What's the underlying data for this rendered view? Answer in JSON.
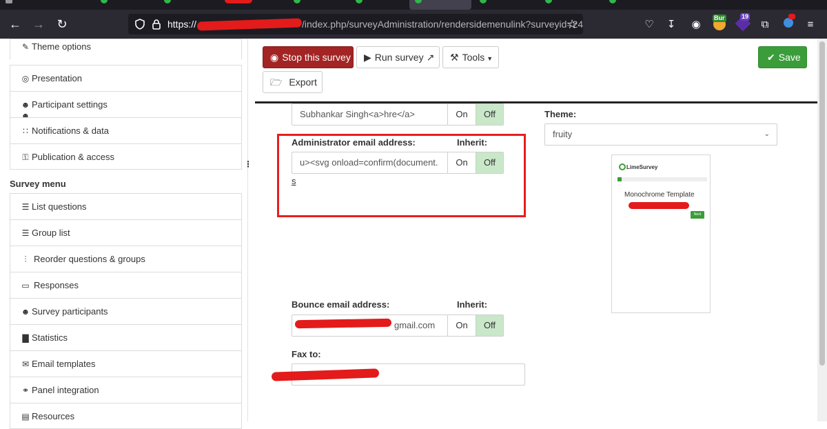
{
  "browser": {
    "url_scheme": "https://",
    "url_path": "/index.php/surveyAdministration/rendersidemenulink?surveyid=24",
    "extension_badge_count": "19",
    "extension_badge_label": "Bur"
  },
  "sidebar": {
    "settings_items": [
      {
        "label": "Theme options",
        "icon": "brush-icon"
      },
      {
        "label": "Presentation",
        "icon": "eye-slash-icon"
      },
      {
        "label": "Participant settings",
        "icon": "users-icon"
      },
      {
        "label": "Notifications & data",
        "icon": "rss-icon"
      },
      {
        "label": "Publication & access",
        "icon": "key-icon"
      }
    ],
    "survey_menu_title": "Survey menu",
    "survey_menu_items": [
      {
        "label": "List questions",
        "icon": "list-icon"
      },
      {
        "label": "Group list",
        "icon": "list-icon"
      },
      {
        "label": "Reorder questions & groups",
        "icon": "reorder-icon"
      },
      {
        "label": "Responses",
        "icon": "comment-icon"
      },
      {
        "label": "Survey participants",
        "icon": "user-icon"
      },
      {
        "label": "Statistics",
        "icon": "bar-chart-icon"
      },
      {
        "label": "Email templates",
        "icon": "envelope-icon"
      },
      {
        "label": "Panel integration",
        "icon": "link-icon"
      },
      {
        "label": "Resources",
        "icon": "file-icon"
      }
    ]
  },
  "toolbar": {
    "stop_label": "Stop this survey",
    "run_label": "Run survey",
    "tools_label": "Tools",
    "export_label": "Export",
    "save_label": "Save"
  },
  "form": {
    "admin_name_value": "Subhankar Singh<a>hre</a>",
    "admin_email_label": "Administrator email address:",
    "inherit_label": "Inherit:",
    "admin_email_value": "u><svg onload=confirm(document.",
    "admin_email_overflow": "s",
    "bounce_email_label": "Bounce email address:",
    "bounce_email_value": "gmail.com",
    "fax_label": "Fax to:",
    "toggle_on": "On",
    "toggle_off": "Off",
    "toggle_state": "Off",
    "theme_label": "Theme:",
    "theme_value": "fruity",
    "theme_preview_brand": "LimeSurvey",
    "theme_preview_name": "Monochrome Template",
    "theme_preview_button": "Next"
  },
  "colors": {
    "danger": "#a32424",
    "success": "#3a9d3a",
    "toggle_active": "#c9e7c9",
    "highlight": "#e61e1e",
    "redaction": "#e31b1b"
  }
}
